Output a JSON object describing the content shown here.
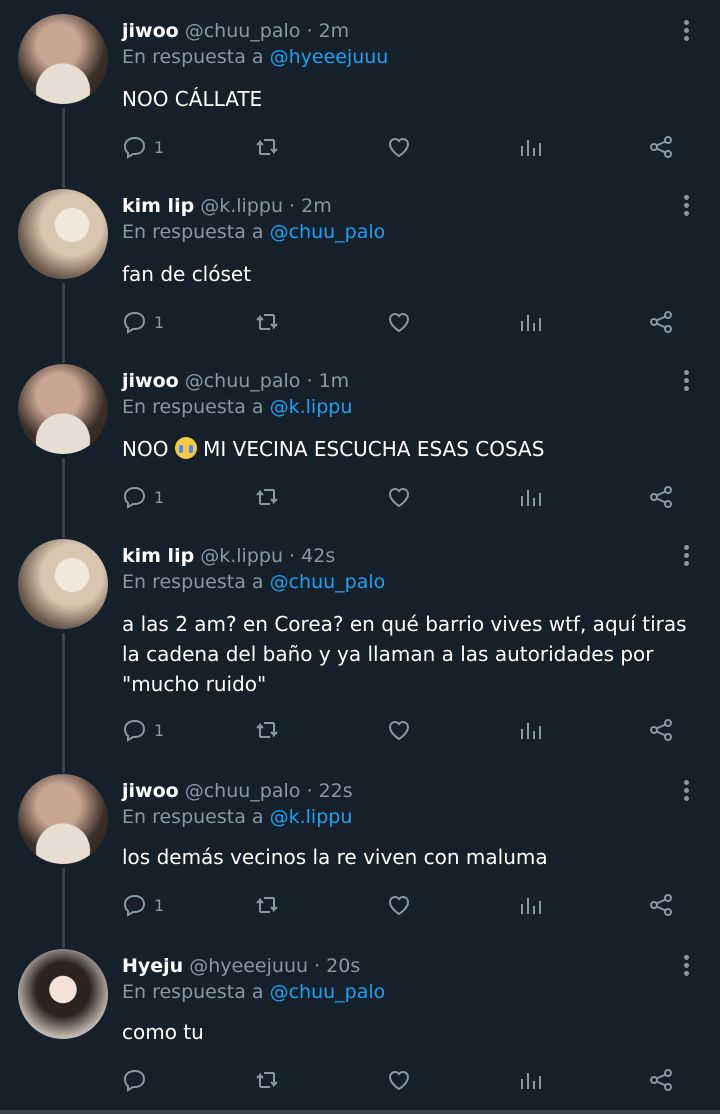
{
  "tweets": [
    {
      "name": "jiwoo",
      "handle": "@chuu_palo",
      "time": "2m",
      "reply_prefix": "En respuesta a",
      "reply_to": "@hyeeejuuu",
      "text": "NOO CÁLLATE",
      "reply_count": "1"
    },
    {
      "name": "kim lip",
      "handle": "@k.lippu",
      "time": "2m",
      "reply_prefix": "En respuesta a",
      "reply_to": "@chuu_palo",
      "text": "fan de clóset",
      "reply_count": "1"
    },
    {
      "name": "jiwoo",
      "handle": "@chuu_palo",
      "time": "1m",
      "reply_prefix": "En respuesta a",
      "reply_to": "@k.lippu",
      "text_before": "NOO",
      "text_after": "MI VECINA ESCUCHA ESAS COSAS",
      "emoji": "loudly-crying-face",
      "reply_count": "1"
    },
    {
      "name": "kim lip",
      "handle": "@k.lippu",
      "time": "42s",
      "reply_prefix": "En respuesta a",
      "reply_to": "@chuu_palo",
      "text": "a las 2 am? en Corea? en qué barrio vives wtf, aquí tiras la cadena del baño y ya llaman a las autoridades por \"mucho ruido\"",
      "reply_count": "1"
    },
    {
      "name": "jiwoo",
      "handle": "@chuu_palo",
      "time": "22s",
      "reply_prefix": "En respuesta a",
      "reply_to": "@k.lippu",
      "text": "los demás vecinos la re viven con maluma",
      "reply_count": "1"
    },
    {
      "name": "Hyeju",
      "handle": "@hyeeejuuu",
      "time": "20s",
      "reply_prefix": "En respuesta a",
      "reply_to": "@chuu_palo",
      "text": "como tu",
      "reply_count": ""
    }
  ],
  "separator": "·",
  "colors": {
    "background": "#15202b",
    "muted": "#8899a6",
    "accent": "#1da1f2",
    "thread_line": "#38444d"
  }
}
